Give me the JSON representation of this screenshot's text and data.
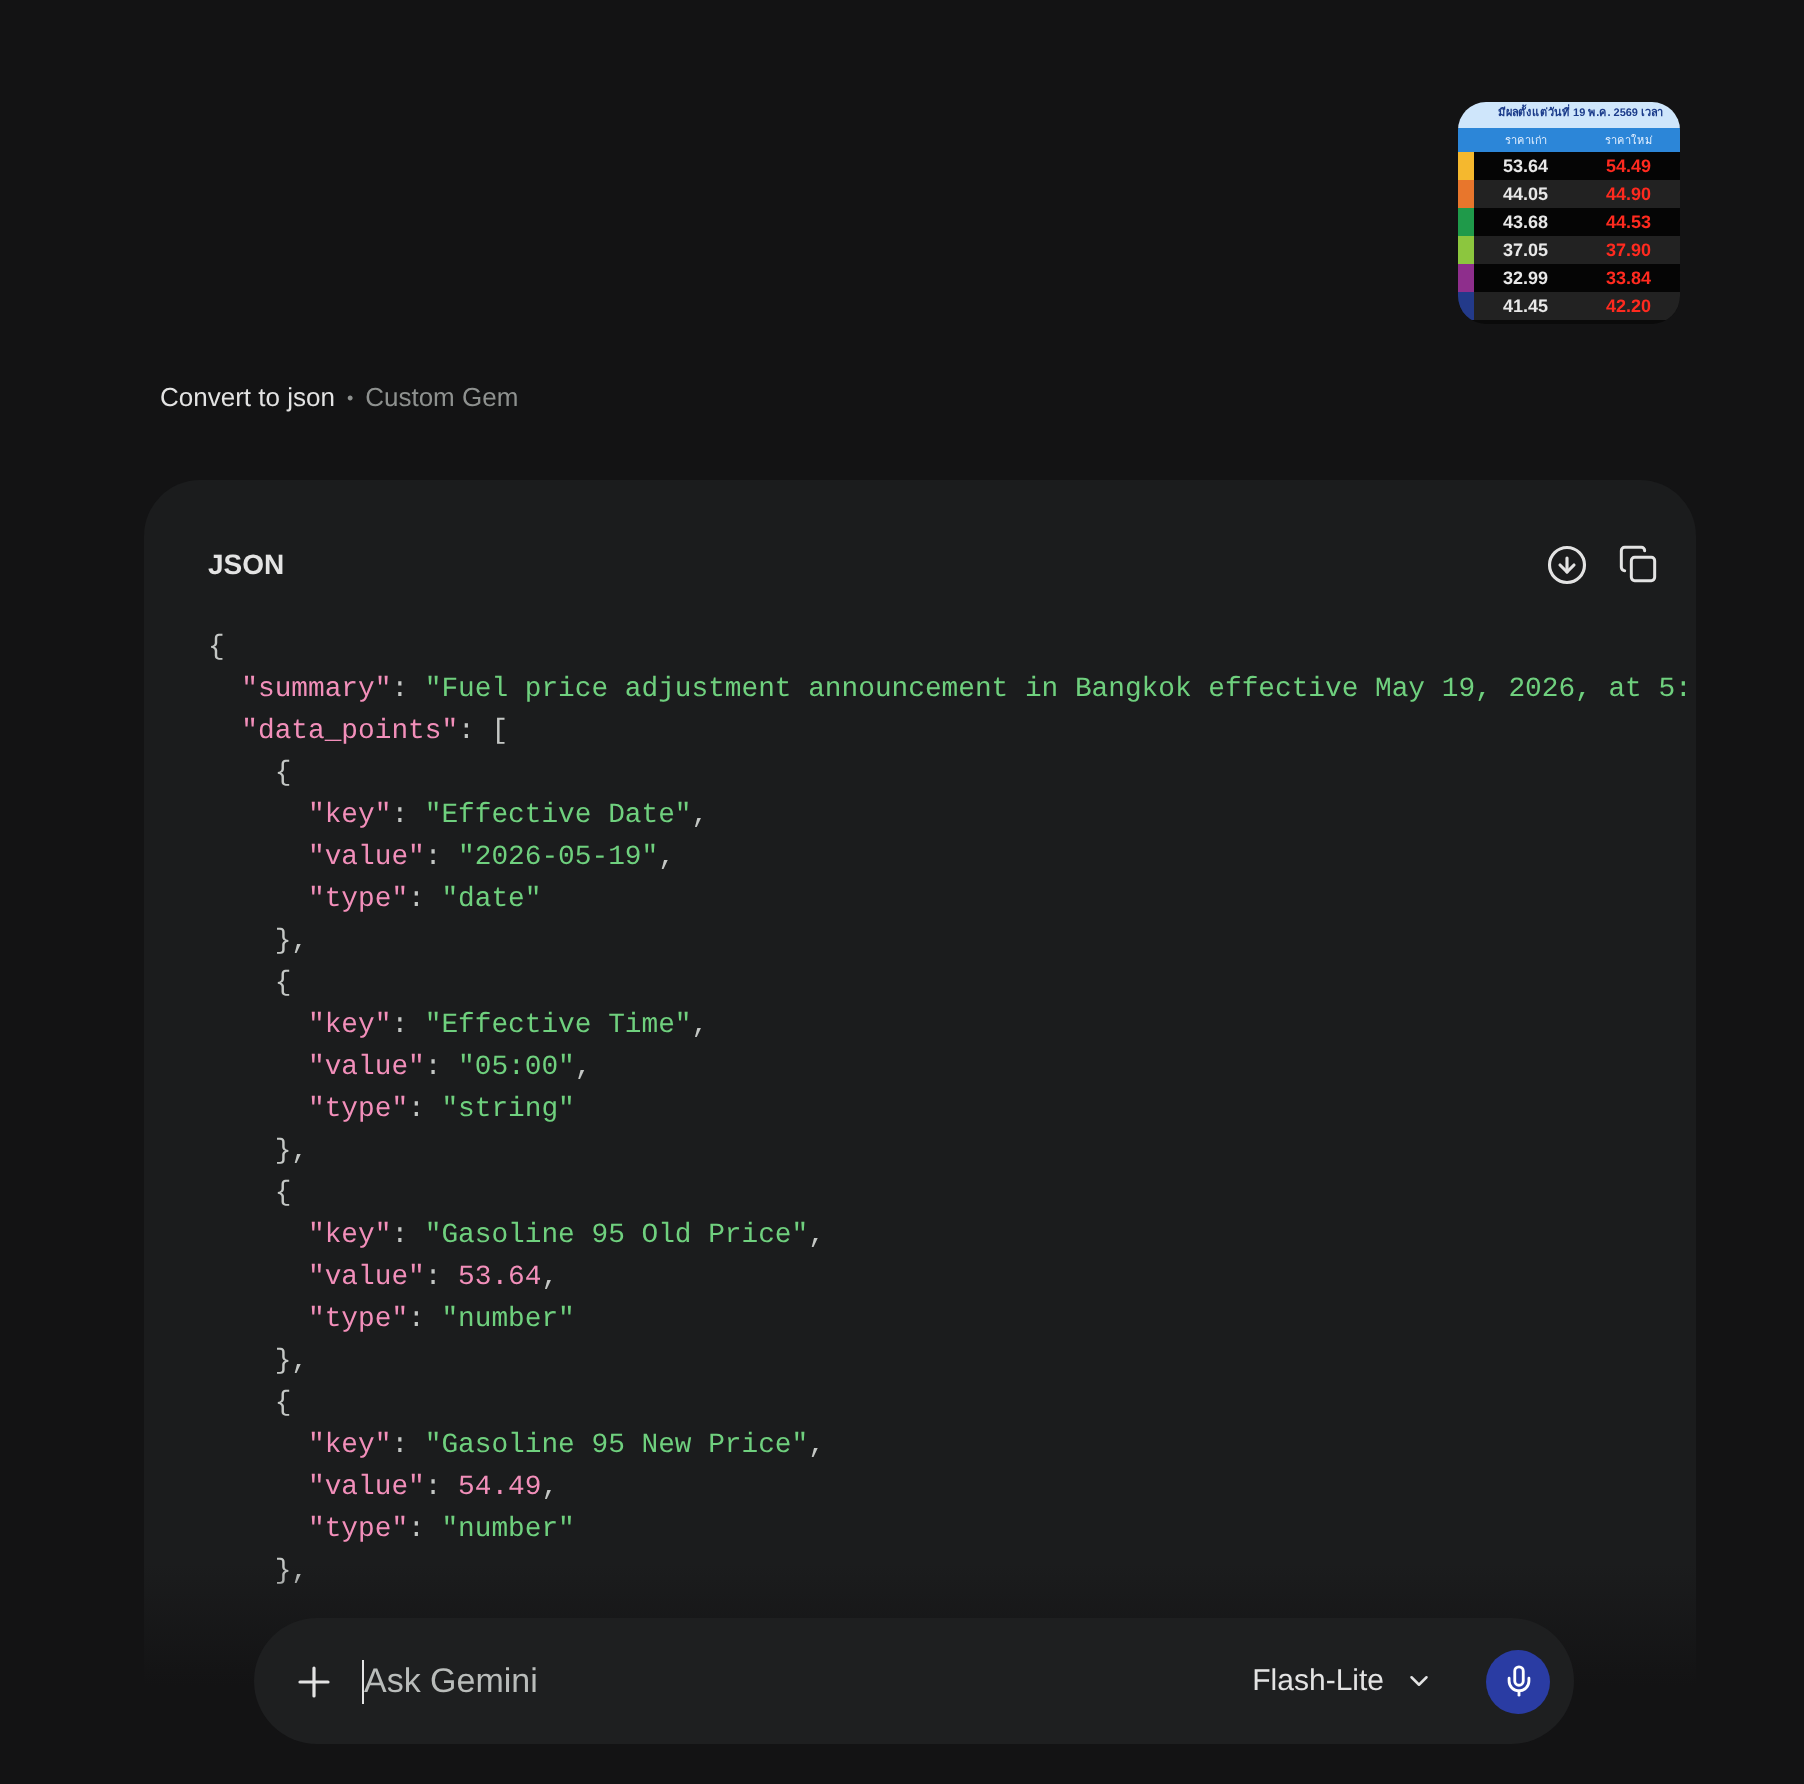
{
  "attachment": {
    "title": "มีผลตั้งแต่วันที่ 19 พ.ค. 2569 เวลา",
    "columns": [
      "ราคาเก่า",
      "ราคาใหม่"
    ],
    "rows": [
      {
        "color": "#f5b82e",
        "old": "53.64",
        "new": "54.49"
      },
      {
        "color": "#e8762c",
        "old": "44.05",
        "new": "44.90"
      },
      {
        "color": "#1f9a4a",
        "old": "43.68",
        "new": "44.53"
      },
      {
        "color": "#8cc63e",
        "old": "37.05",
        "new": "37.90"
      },
      {
        "color": "#8e2e8c",
        "old": "32.99",
        "new": "33.84"
      },
      {
        "color": "#233a8a",
        "old": "41.45",
        "new": "42.20"
      }
    ]
  },
  "gem": {
    "name": "Convert to json",
    "separator": "•",
    "label": "Custom Gem"
  },
  "code_block": {
    "language": "JSON",
    "lines": [
      [
        {
          "kind": "punct",
          "text": "{"
        }
      ],
      [
        {
          "kind": "key",
          "text": "  \"summary\""
        },
        {
          "kind": "punct",
          "text": ": "
        },
        {
          "kind": "string",
          "text": "\"Fuel price adjustment announcement in Bangkok effective May 19, 2026, at 5:"
        }
      ],
      [
        {
          "kind": "key",
          "text": "  \"data_points\""
        },
        {
          "kind": "punct",
          "text": ": ["
        }
      ],
      [
        {
          "kind": "punct",
          "text": "    {"
        }
      ],
      [
        {
          "kind": "key",
          "text": "      \"key\""
        },
        {
          "kind": "punct",
          "text": ": "
        },
        {
          "kind": "string",
          "text": "\"Effective Date\""
        },
        {
          "kind": "punct",
          "text": ","
        }
      ],
      [
        {
          "kind": "key",
          "text": "      \"value\""
        },
        {
          "kind": "punct",
          "text": ": "
        },
        {
          "kind": "string",
          "text": "\"2026-05-19\""
        },
        {
          "kind": "punct",
          "text": ","
        }
      ],
      [
        {
          "kind": "key",
          "text": "      \"type\""
        },
        {
          "kind": "punct",
          "text": ": "
        },
        {
          "kind": "string",
          "text": "\"date\""
        }
      ],
      [
        {
          "kind": "punct",
          "text": "    },"
        }
      ],
      [
        {
          "kind": "punct",
          "text": "    {"
        }
      ],
      [
        {
          "kind": "key",
          "text": "      \"key\""
        },
        {
          "kind": "punct",
          "text": ": "
        },
        {
          "kind": "string",
          "text": "\"Effective Time\""
        },
        {
          "kind": "punct",
          "text": ","
        }
      ],
      [
        {
          "kind": "key",
          "text": "      \"value\""
        },
        {
          "kind": "punct",
          "text": ": "
        },
        {
          "kind": "string",
          "text": "\"05:00\""
        },
        {
          "kind": "punct",
          "text": ","
        }
      ],
      [
        {
          "kind": "key",
          "text": "      \"type\""
        },
        {
          "kind": "punct",
          "text": ": "
        },
        {
          "kind": "string",
          "text": "\"string\""
        }
      ],
      [
        {
          "kind": "punct",
          "text": "    },"
        }
      ],
      [
        {
          "kind": "punct",
          "text": "    {"
        }
      ],
      [
        {
          "kind": "key",
          "text": "      \"key\""
        },
        {
          "kind": "punct",
          "text": ": "
        },
        {
          "kind": "string",
          "text": "\"Gasoline 95 Old Price\""
        },
        {
          "kind": "punct",
          "text": ","
        }
      ],
      [
        {
          "kind": "key",
          "text": "      \"value\""
        },
        {
          "kind": "punct",
          "text": ": "
        },
        {
          "kind": "number",
          "text": "53.64"
        },
        {
          "kind": "punct",
          "text": ","
        }
      ],
      [
        {
          "kind": "key",
          "text": "      \"type\""
        },
        {
          "kind": "punct",
          "text": ": "
        },
        {
          "kind": "string",
          "text": "\"number\""
        }
      ],
      [
        {
          "kind": "punct",
          "text": "    },"
        }
      ],
      [
        {
          "kind": "punct",
          "text": "    {"
        }
      ],
      [
        {
          "kind": "key",
          "text": "      \"key\""
        },
        {
          "kind": "punct",
          "text": ": "
        },
        {
          "kind": "string",
          "text": "\"Gasoline 95 New Price\""
        },
        {
          "kind": "punct",
          "text": ","
        }
      ],
      [
        {
          "kind": "key",
          "text": "      \"value\""
        },
        {
          "kind": "punct",
          "text": ": "
        },
        {
          "kind": "number",
          "text": "54.49"
        },
        {
          "kind": "punct",
          "text": ","
        }
      ],
      [
        {
          "kind": "key",
          "text": "      \"type\""
        },
        {
          "kind": "punct",
          "text": ": "
        },
        {
          "kind": "string",
          "text": "\"number\""
        }
      ],
      [
        {
          "kind": "punct",
          "text": "    },"
        }
      ]
    ]
  },
  "prompt": {
    "placeholder": "Ask Gemini",
    "model": "Flash-Lite"
  }
}
